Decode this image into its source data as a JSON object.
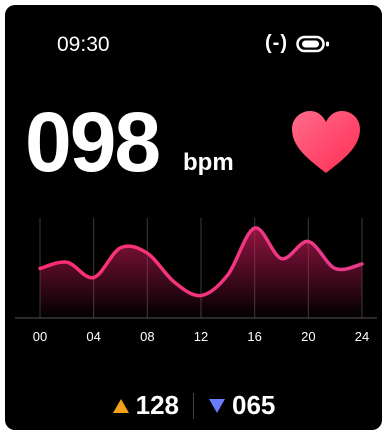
{
  "status_bar": {
    "time": "09:30",
    "heart_glyph": "(-)",
    "icons": [
      "heart-rate-sensor-icon",
      "battery-icon"
    ]
  },
  "heart_rate": {
    "value": "098",
    "unit": "bpm",
    "icon": "heart-icon"
  },
  "chart_data": {
    "type": "area",
    "x_ticks": [
      "00",
      "04",
      "08",
      "12",
      "16",
      "20",
      "24"
    ],
    "x": [
      0,
      2,
      4,
      6,
      8,
      10,
      12,
      14,
      16,
      18,
      20,
      22,
      24
    ],
    "series": [
      {
        "values": [
          0.55,
          0.62,
          0.45,
          0.78,
          0.72,
          0.4,
          0.25,
          0.48,
          1.0,
          0.66,
          0.85,
          0.55,
          0.6
        ]
      }
    ],
    "grid": true,
    "colors": {
      "line_start": "#ff2e6e",
      "line_end": "#e83a8c",
      "fill": "#c21a55",
      "grid": "#3a3a3a"
    }
  },
  "stats": {
    "max": {
      "value": "128",
      "icon": "up-triangle-icon",
      "color": "#f4a11a"
    },
    "min": {
      "value": "065",
      "icon": "down-triangle-icon",
      "color": "#6a7cff"
    }
  },
  "colors": {
    "background": "#000000",
    "heart": "#ff3a6b"
  }
}
